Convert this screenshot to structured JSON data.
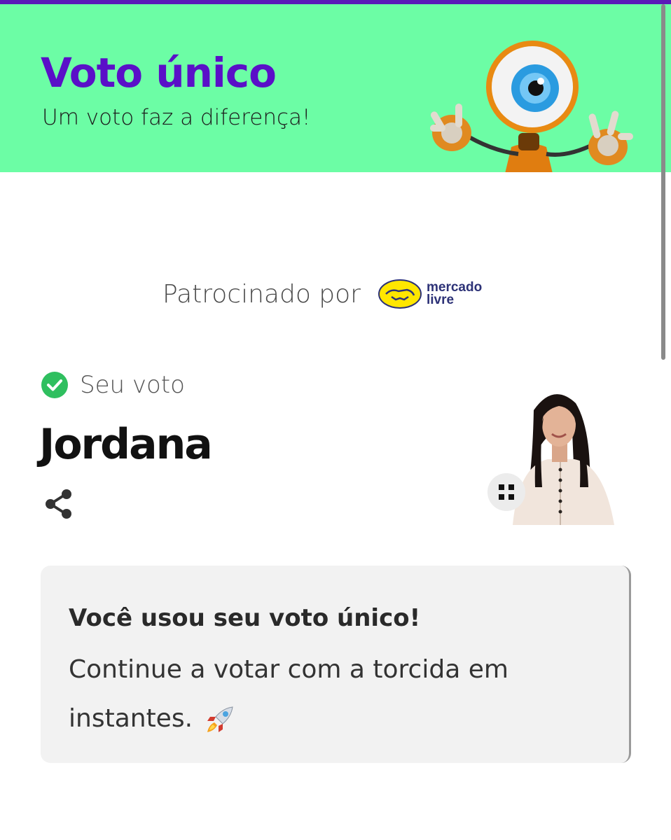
{
  "banner": {
    "title": "Voto único",
    "subtitle": "Um voto faz a diferença!",
    "mascot_icon": "big-brother-eye-mascot"
  },
  "sponsor": {
    "label": "Patrocinado por",
    "brand_line1": "mercado",
    "brand_line2": "livre"
  },
  "vote": {
    "status_label": "Seu voto",
    "status_icon": "check-circle-icon",
    "candidate": "Jordana"
  },
  "card": {
    "title": "Você usou seu voto único!",
    "body": "Continue a votar com a torcida em instantes.",
    "emoji_icon": "rocket-icon"
  },
  "colors": {
    "accent": "#5a0fc8",
    "banner_bg": "#6cfda5",
    "check": "#2fbf5f",
    "card_bg": "#f2f2f2"
  }
}
